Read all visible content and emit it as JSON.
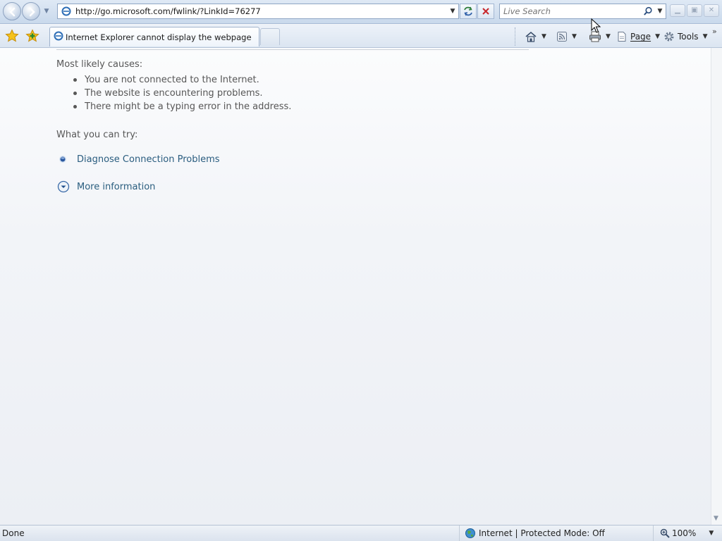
{
  "address_bar": {
    "url": "http://go.microsoft.com/fwlink/?LinkId=76277"
  },
  "search": {
    "placeholder": "Live Search"
  },
  "tab": {
    "title": "Internet Explorer cannot display the webpage"
  },
  "command_bar": {
    "page_label": "Page",
    "tools_label": "Tools"
  },
  "content": {
    "causes_heading": "Most likely causes:",
    "causes": [
      "You are not connected to the Internet.",
      "The website is encountering problems.",
      "There might be a typing error in the address."
    ],
    "try_heading": "What you can try:",
    "diagnose_label": "Diagnose Connection Problems",
    "more_info_label": "More information"
  },
  "status_bar": {
    "status": "Done",
    "zone": "Internet | Protected Mode: Off",
    "zoom": "100%"
  },
  "colors": {
    "link": "#2a5d7f",
    "body_text": "#575757",
    "chrome": "#dbe5f1"
  }
}
